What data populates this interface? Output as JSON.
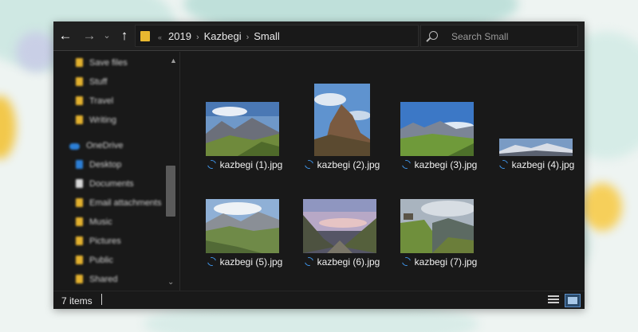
{
  "address": {
    "crumbs": [
      "2019",
      "Kazbegi",
      "Small"
    ],
    "overflow_marker": "«"
  },
  "search": {
    "placeholder": "Search Small"
  },
  "sidebar": {
    "items": [
      {
        "label": "Save files",
        "icon": "folder-icon"
      },
      {
        "label": "Stuff",
        "icon": "folder-icon"
      },
      {
        "label": "Travel",
        "icon": "folder-icon"
      },
      {
        "label": "Writing",
        "icon": "folder-icon"
      },
      {
        "label": "OneDrive",
        "icon": "cloud-icon"
      },
      {
        "label": "Desktop",
        "icon": "desktop-icon"
      },
      {
        "label": "Documents",
        "icon": "document-icon"
      },
      {
        "label": "Email attachments",
        "icon": "folder-icon"
      },
      {
        "label": "Music",
        "icon": "folder-icon"
      },
      {
        "label": "Pictures",
        "icon": "folder-icon"
      },
      {
        "label": "Public",
        "icon": "folder-icon"
      },
      {
        "label": "Shared",
        "icon": "folder-icon"
      }
    ]
  },
  "files": [
    {
      "name": "kazbegi (1).jpg"
    },
    {
      "name": "kazbegi (2).jpg"
    },
    {
      "name": "kazbegi (3).jpg"
    },
    {
      "name": "kazbegi (4).jpg"
    },
    {
      "name": "kazbegi (5).jpg"
    },
    {
      "name": "kazbegi (6).jpg"
    },
    {
      "name": "kazbegi (7).jpg"
    }
  ],
  "status": {
    "item_count": "7 items"
  },
  "colors": {
    "window_bg": "#191919",
    "sync_accent": "#3d8fe0",
    "folder": "#e3b12e"
  }
}
